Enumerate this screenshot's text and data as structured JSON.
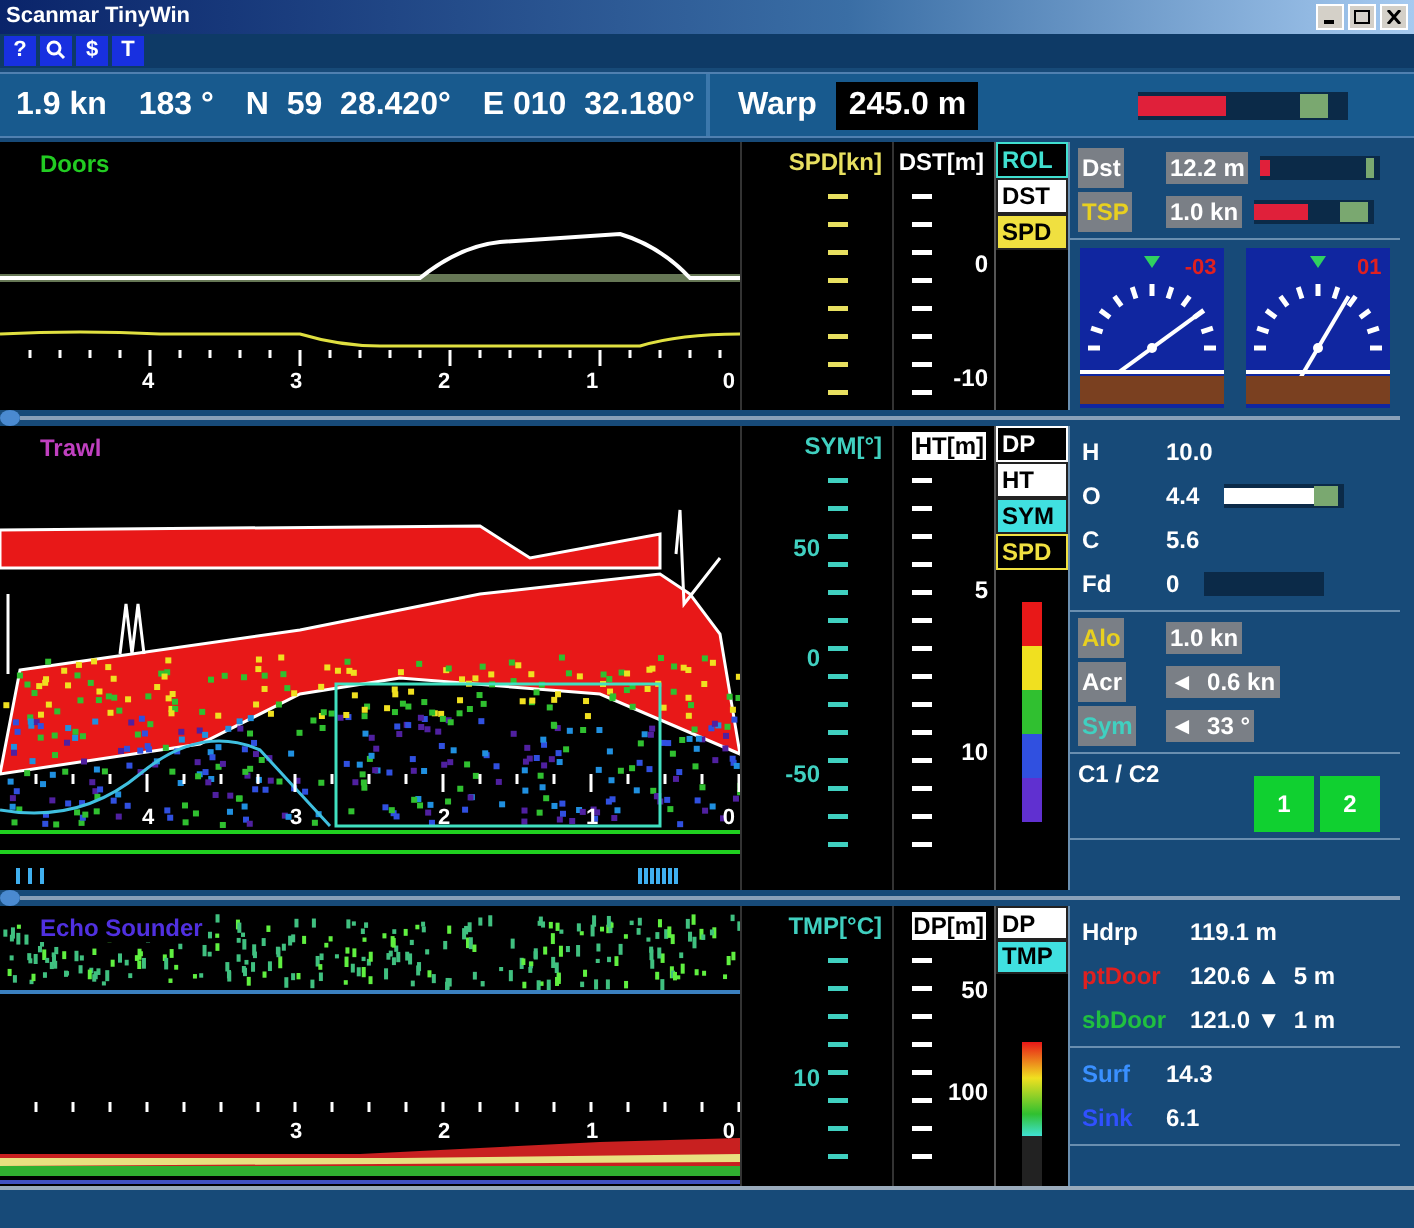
{
  "window": {
    "title": "Scanmar TinyWin"
  },
  "toolbar": [
    {
      "kind": "glyph",
      "label": "?"
    },
    {
      "kind": "search"
    },
    {
      "kind": "glyph",
      "label": "$"
    },
    {
      "kind": "glyph",
      "label": "T"
    }
  ],
  "nav": {
    "speed": "1.9 kn",
    "heading": "183 °",
    "latitude": "N  59  28.420°",
    "longitude": "E 010  32.180°"
  },
  "warp": {
    "label": "Warp",
    "value": "245.0 m",
    "level": 0.42
  },
  "panels": [
    {
      "kind": "doors",
      "title": "Doors",
      "color": "#22cc22",
      "axis_labels": [
        "4",
        "3",
        "2",
        "1",
        "0"
      ],
      "scales": [
        {
          "label": "SPD[kn]",
          "color": "#e8e060",
          "boxed": false
        },
        {
          "label": "DST[m]",
          "color": "#ffffff",
          "boxed": false,
          "ticks": [
            "0",
            "-10"
          ]
        }
      ],
      "buttons": [
        {
          "label": "ROL",
          "color": "#40e0d0",
          "selected": false
        },
        {
          "label": "DST",
          "color": "#ffffff",
          "selected": true
        },
        {
          "label": "SPD",
          "color": "#f0e040",
          "selected": true
        }
      ],
      "side": [
        {
          "kind": "rows",
          "rows": [
            {
              "kind": "bar",
              "label": "Dst",
              "color": "#ffffff",
              "boxed": true,
              "value": "12.2 m",
              "level": 0.08
            },
            {
              "kind": "bar",
              "label": "TSP",
              "color": "#e8d020",
              "boxed": true,
              "value": "1.0 kn",
              "level": 0.45
            }
          ]
        },
        {
          "kind": "gauges",
          "gauges": [
            {
              "reading": "-03"
            },
            {
              "reading": "01"
            }
          ]
        }
      ]
    },
    {
      "kind": "trawl",
      "title": "Trawl",
      "color": "#c040c0",
      "axis_labels": [
        "4",
        "3",
        "2",
        "1",
        "0"
      ],
      "scales": [
        {
          "label": "SYM[°]",
          "color": "#40d0c0",
          "boxed": false,
          "ticks": [
            "50",
            "0",
            "-50"
          ]
        },
        {
          "label": "HT[m]",
          "color": "#ffffff",
          "boxed": true,
          "ticks": [
            "5",
            "10"
          ]
        }
      ],
      "buttons": [
        {
          "label": "DP",
          "color": "#ffffff",
          "selected": false
        },
        {
          "label": "HT",
          "color": "#ffffff",
          "selected": true
        },
        {
          "label": "SYM",
          "color": "#40e0e0",
          "selected": true
        },
        {
          "label": "SPD",
          "color": "#f0e040",
          "selected": false
        }
      ],
      "side": [
        {
          "kind": "rows",
          "rows": [
            {
              "kind": "text",
              "label": "H",
              "color": "#ffffff",
              "boxed": false,
              "value": "10.0"
            },
            {
              "kind": "slider",
              "label": "O",
              "color": "#ffffff",
              "boxed": false,
              "value": "4.4",
              "level": 0.85
            },
            {
              "kind": "text",
              "label": "C",
              "color": "#ffffff",
              "boxed": false,
              "value": "5.6"
            },
            {
              "kind": "track",
              "label": "Fd",
              "color": "#ffffff",
              "boxed": false,
              "value": "0"
            }
          ]
        },
        {
          "kind": "rows",
          "rows": [
            {
              "kind": "text",
              "label": "Alo",
              "color": "#e8d020",
              "boxed": true,
              "value": "1.0 kn"
            },
            {
              "kind": "text",
              "label": "Acr",
              "color": "#ffffff",
              "boxed": true,
              "value": "◄  0.6 kn"
            },
            {
              "kind": "text",
              "label": "Sym",
              "color": "#40d0c0",
              "boxed": true,
              "value": "◄  33 °"
            }
          ]
        },
        {
          "kind": "switches",
          "label": "C1 / C2",
          "buttons": [
            "1",
            "2"
          ]
        }
      ]
    },
    {
      "kind": "echo",
      "title": "Echo Sounder",
      "color": "#5030e0",
      "axis_labels": [
        "3",
        "2",
        "1",
        "0"
      ],
      "scales": [
        {
          "label": "TMP[°C]",
          "color": "#40d0c0",
          "boxed": false,
          "ticks": [
            "10"
          ]
        },
        {
          "label": "DP[m]",
          "color": "#ffffff",
          "boxed": true,
          "ticks": [
            "50",
            "100"
          ]
        }
      ],
      "buttons": [
        {
          "label": "DP",
          "color": "#ffffff",
          "selected": true
        },
        {
          "label": "TMP",
          "color": "#40e0e0",
          "selected": true
        }
      ],
      "side": [
        {
          "kind": "rows",
          "rows": [
            {
              "kind": "text",
              "label": "Hdrp",
              "color": "#ffffff",
              "boxed": false,
              "value": "119.1 m"
            },
            {
              "kind": "text",
              "label": "ptDoor",
              "color": "#e02020",
              "boxed": false,
              "value": "120.6 ▲  5 m"
            },
            {
              "kind": "text",
              "label": "sbDoor",
              "color": "#20c040",
              "boxed": false,
              "value": "121.0 ▼  1 m"
            }
          ]
        },
        {
          "kind": "rows",
          "rows": [
            {
              "kind": "text",
              "label": "Surf",
              "color": "#3a90ff",
              "boxed": false,
              "value": "14.3"
            },
            {
              "kind": "text",
              "label": "Sink",
              "color": "#3050ff",
              "boxed": false,
              "value": "6.1"
            }
          ]
        }
      ]
    }
  ]
}
